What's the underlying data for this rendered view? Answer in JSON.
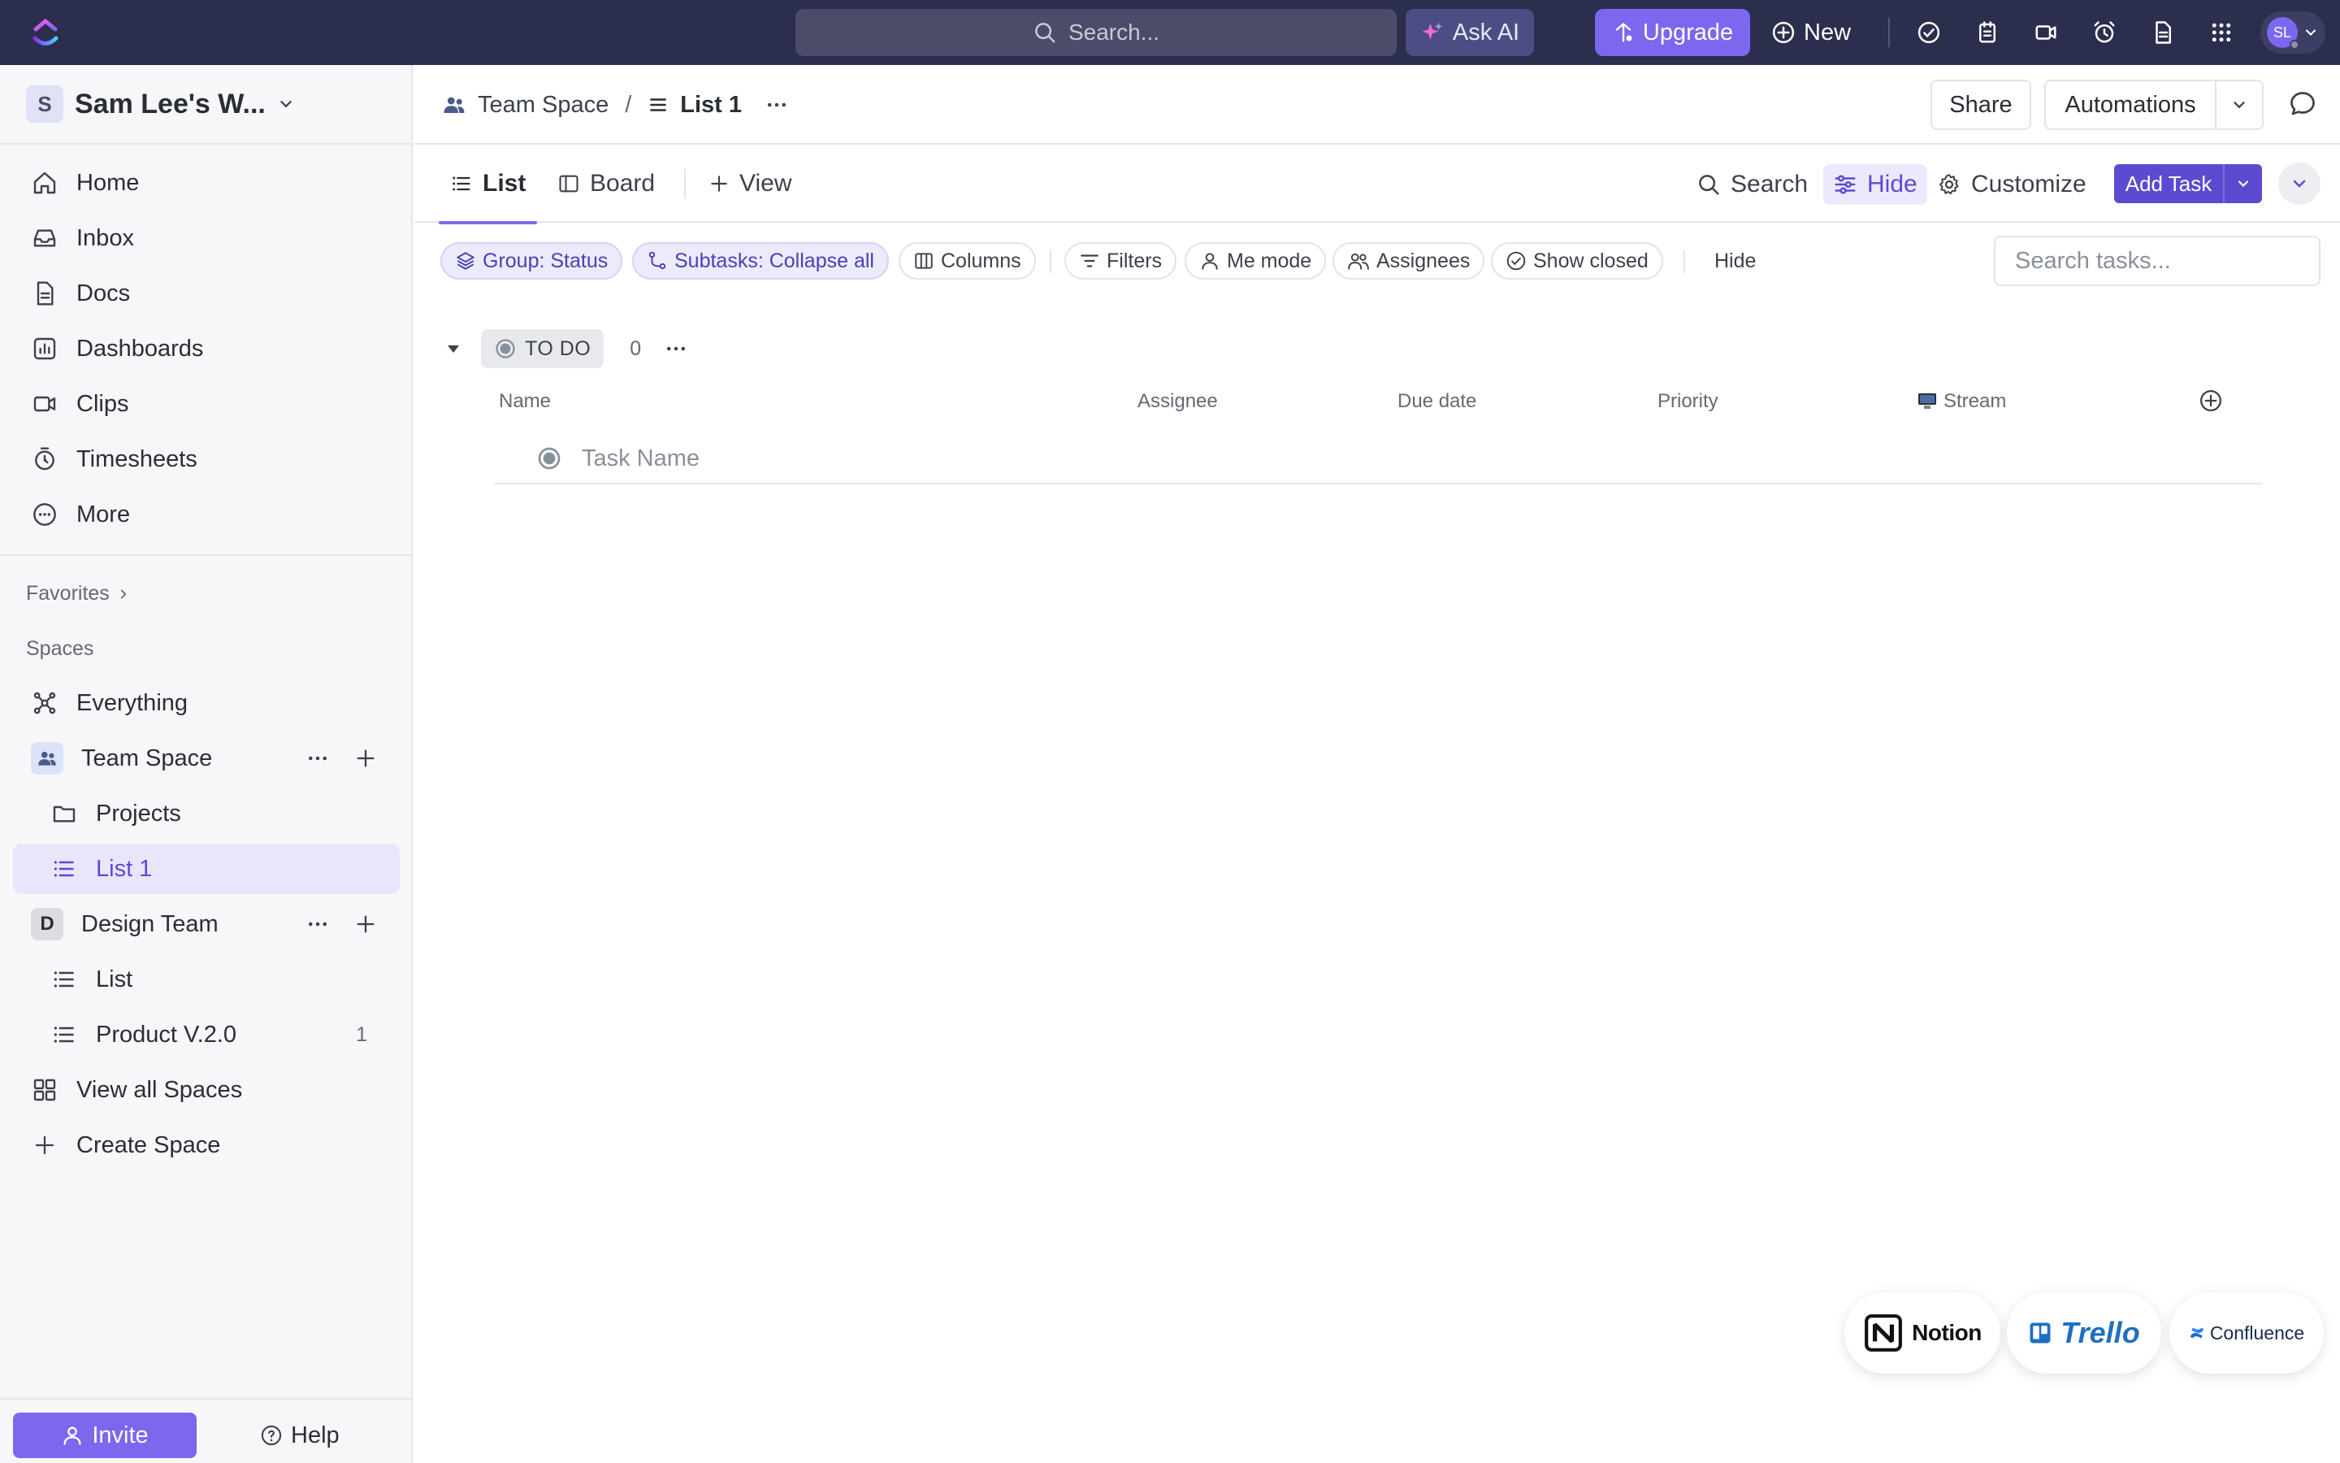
{
  "topbar": {
    "search_placeholder": "Search...",
    "ask_ai": "Ask AI",
    "upgrade": "Upgrade",
    "new": "New",
    "avatar_initials": "SL",
    "colors": {
      "bar": "#2c2e4e",
      "accent": "#7b68ee"
    }
  },
  "sidebar": {
    "workspace_initial": "S",
    "workspace_name": "Sam Lee's W...",
    "nav": [
      {
        "label": "Home",
        "icon": "home-icon"
      },
      {
        "label": "Inbox",
        "icon": "inbox-icon"
      },
      {
        "label": "Docs",
        "icon": "doc-icon"
      },
      {
        "label": "Dashboards",
        "icon": "dashboard-icon"
      },
      {
        "label": "Clips",
        "icon": "video-icon"
      },
      {
        "label": "Timesheets",
        "icon": "timer-icon"
      },
      {
        "label": "More",
        "icon": "more-icon"
      }
    ],
    "favorites_label": "Favorites",
    "spaces_label": "Spaces",
    "spaces": {
      "everything": "Everything",
      "team_space": "Team Space",
      "projects": "Projects",
      "list1": "List 1",
      "design_initial": "D",
      "design_team": "Design Team",
      "list": "List",
      "product": "Product V.2.0",
      "product_count": "1",
      "view_all": "View all Spaces",
      "create": "Create Space"
    },
    "invite": "Invite",
    "help": "Help"
  },
  "breadcrumb": {
    "space": "Team Space",
    "separator": "/",
    "list": "List 1",
    "share": "Share",
    "automations": "Automations"
  },
  "tabs": {
    "list": "List",
    "board": "Board",
    "view": "View",
    "search": "Search",
    "hide": "Hide",
    "customize": "Customize",
    "add_task": "Add Task"
  },
  "filters": {
    "group": "Group: Status",
    "subtasks": "Subtasks: Collapse all",
    "columns": "Columns",
    "filters": "Filters",
    "me_mode": "Me mode",
    "assignees": "Assignees",
    "show_closed": "Show closed",
    "hide": "Hide",
    "search_placeholder": "Search tasks..."
  },
  "group": {
    "status": "TO DO",
    "count": "0"
  },
  "columns": {
    "name": "Name",
    "assignee": "Assignee",
    "due_date": "Due date",
    "priority": "Priority",
    "stream": "Stream"
  },
  "task_placeholder": "Task Name",
  "integrations": {
    "notion": "Notion",
    "trello": "Trello",
    "confluence": "Confluence"
  }
}
